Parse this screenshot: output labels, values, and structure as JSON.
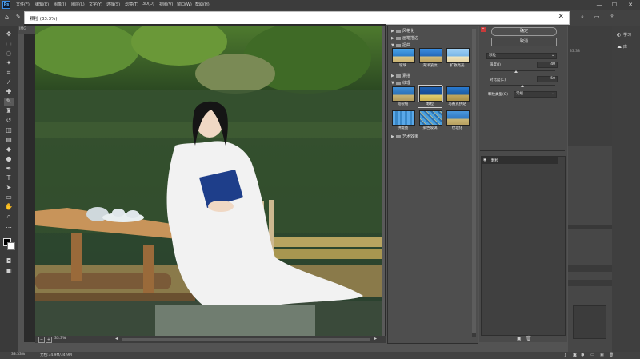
{
  "menubar": {
    "items": [
      "文件(F)",
      "编辑(E)",
      "图像(I)",
      "图层(L)",
      "文字(Y)",
      "选择(S)",
      "滤镜(T)",
      "3D(D)",
      "视图(V)",
      "窗口(W)",
      "帮助(H)"
    ],
    "controls": {
      "minimize": "—",
      "maximize": "☐",
      "close": "✕"
    }
  },
  "dialog": {
    "title": "颗粒 (33.3%)",
    "close_glyph": "✕"
  },
  "document": {
    "tab": "IMG",
    "zoom_percent": "33.3%",
    "zoom_level": 33.3
  },
  "gallery": {
    "categories": [
      {
        "name": "风格化",
        "expanded": false
      },
      {
        "name": "画笔描边",
        "expanded": false
      },
      {
        "name": "扭曲",
        "expanded": true,
        "filters": [
          "玻璃",
          "海洋波纹",
          "扩散亮光"
        ]
      },
      {
        "name": "素描",
        "expanded": false
      },
      {
        "name": "纹理",
        "expanded": true,
        "filters": [
          "龟裂缝",
          "颗粒",
          "马赛克拼贴",
          "拼缀图",
          "染色玻璃",
          "纹理化"
        ]
      },
      {
        "name": "艺术效果",
        "expanded": false
      }
    ],
    "selected_filter": "颗粒"
  },
  "settings": {
    "ok_label": "确定",
    "cancel_label": "取消",
    "filter_select": "颗粒",
    "params": [
      {
        "label": "强度(I)",
        "value": "40",
        "fraction": 0.4
      },
      {
        "label": "对比度(C)",
        "value": "50",
        "fraction": 0.5
      }
    ],
    "grain_type_label": "颗粒类型(G)",
    "grain_type_value": "常规"
  },
  "effect_layers": {
    "items": [
      "颗粒"
    ]
  },
  "ps_panels": {
    "tabs": [
      "学习",
      "库"
    ],
    "side_text": "33.38"
  },
  "statusbar": {
    "zoom": "33.33%",
    "doc": "文档:34.9M/34.9M"
  },
  "colors": {
    "accent_blue": "#1d5fb2",
    "panel_bg": "#4a4a4a",
    "menubar_bg": "#3c3c3c"
  }
}
